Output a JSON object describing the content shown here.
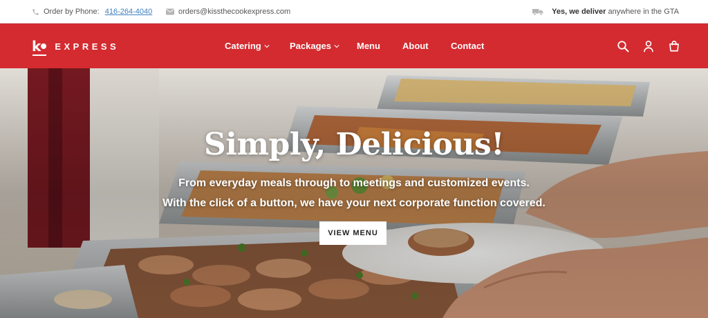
{
  "topbar": {
    "phone_prefix": "Order by Phone:",
    "phone_number": "416-264-4040",
    "email": "orders@kissthecookexpress.com",
    "deliver_bold": "Yes, we deliver",
    "deliver_rest": " anywhere in the GTA"
  },
  "brand": {
    "mark": "k",
    "word": "EXPRESS",
    "color": "#d42b30"
  },
  "nav": {
    "catering": "Catering",
    "packages": "Packages",
    "menu": "Menu",
    "about": "About",
    "contact": "Contact",
    "icons": [
      "search-icon",
      "account-icon",
      "cart-icon"
    ]
  },
  "hero": {
    "title": "Simply, Delicious!",
    "line1": "From everyday meals through to meetings and customized events.",
    "line2": "With the click of a button, we have your next corporate function covered.",
    "cta": "VIEW MENU"
  }
}
